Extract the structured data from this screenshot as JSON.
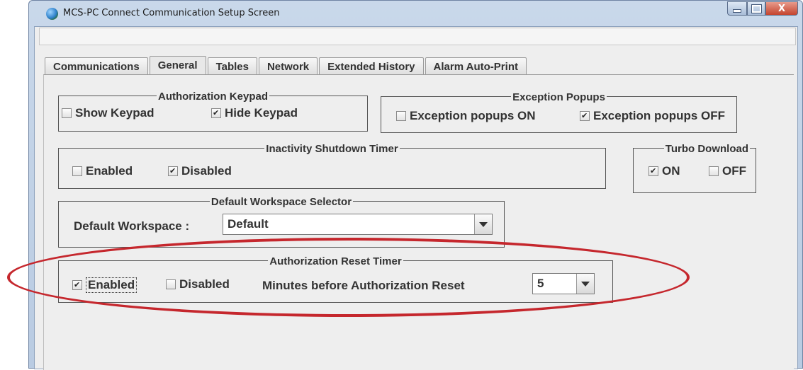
{
  "window": {
    "title": "MCS-PC Connect Communication Setup Screen",
    "close_glyph": "X"
  },
  "tabs": [
    {
      "label": "Communications",
      "active": false
    },
    {
      "label": "General",
      "active": true
    },
    {
      "label": "Tables",
      "active": false
    },
    {
      "label": "Network",
      "active": false
    },
    {
      "label": "Extended History",
      "active": false
    },
    {
      "label": "Alarm Auto-Print",
      "active": false
    }
  ],
  "auth_keypad": {
    "title": "Authorization Keypad",
    "show": {
      "label": "Show Keypad",
      "checked": false
    },
    "hide": {
      "label": "Hide Keypad",
      "checked": true
    }
  },
  "exception_popups": {
    "title": "Exception Popups",
    "on": {
      "label": "Exception popups ON",
      "checked": false
    },
    "off": {
      "label": "Exception popups OFF",
      "checked": true
    }
  },
  "inactivity": {
    "title": "Inactivity Shutdown Timer",
    "enabled": {
      "label": "Enabled",
      "checked": false
    },
    "disabled": {
      "label": "Disabled",
      "checked": true
    }
  },
  "turbo": {
    "title": "Turbo Download",
    "on": {
      "label": "ON",
      "checked": true
    },
    "off": {
      "label": "OFF",
      "checked": false
    }
  },
  "workspace": {
    "title": "Default Workspace Selector",
    "label": "Default Workspace :",
    "value": "Default"
  },
  "auth_reset": {
    "title": "Authorization Reset Timer",
    "enabled": {
      "label": "Enabled",
      "checked": true
    },
    "disabled": {
      "label": "Disabled",
      "checked": false
    },
    "minutes_label": "Minutes before Authorization Reset",
    "minutes_value": "5"
  },
  "colors": {
    "highlight_ellipse": "#c5272d"
  }
}
